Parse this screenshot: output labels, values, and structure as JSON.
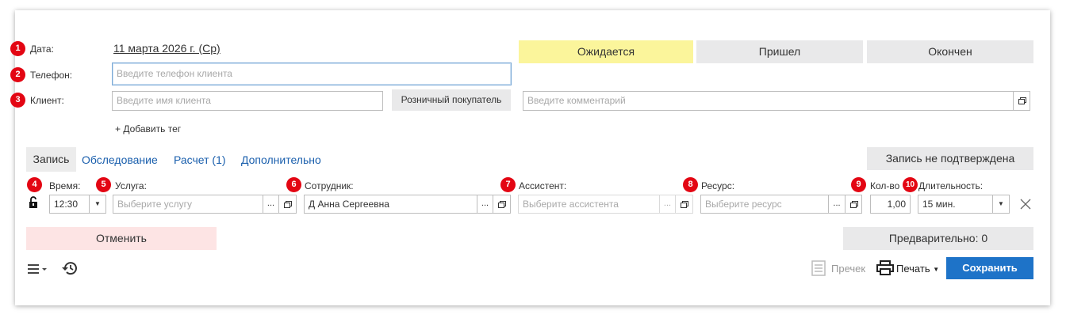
{
  "header": {
    "date_badge": "1",
    "date_label": "Дата:",
    "date_value": "11 марта 2026 г. (Ср)",
    "phone_badge": "2",
    "phone_label": "Телефон:",
    "phone_placeholder": "Введите телефон клиента",
    "client_badge": "3",
    "client_label": "Клиент:",
    "client_placeholder": "Введите имя клиента",
    "retail_button": "Розничный покупатель",
    "comment_placeholder": "Введите комментарий",
    "add_tag": "+ Добавить тег"
  },
  "status": {
    "waiting": "Ожидается",
    "arrived": "Пришел",
    "finished": "Окончен",
    "waiting_color": "#fbf59b"
  },
  "tabs": [
    "Запись",
    "Обследование",
    "Расчет (1)",
    "Дополнительно"
  ],
  "unconfirmed_button": "Запись не подтверждена",
  "row": {
    "time_badge": "4",
    "time_label": "Время:",
    "time_value": "12:30",
    "service_badge": "5",
    "service_label": "Услуга:",
    "service_placeholder": "Выберите услугу",
    "staff_badge": "6",
    "staff_label": "Сотрудник:",
    "staff_value": "Д Анна Сергеевна",
    "assistant_badge": "7",
    "assistant_label": "Ассистент:",
    "assistant_placeholder": "Выберите ассистента",
    "resource_badge": "8",
    "resource_label": "Ресурс:",
    "resource_placeholder": "Выберите ресурс",
    "qty_badge": "9",
    "qty_label": "Кол-во",
    "qty_value": "1,00",
    "duration_badge": "10",
    "duration_label": "Длительность:",
    "duration_value": "15 мин.",
    "ellipsis": "..."
  },
  "cancel_button": "Отменить",
  "prelim_button": "Предварительно: 0",
  "footer": {
    "receipt_label": "Пречек",
    "print_label": "Печать",
    "save_button": "Сохранить",
    "save_color": "#1e73c8"
  },
  "icons": {
    "menu": "menu-icon",
    "history": "history-icon",
    "lock": "unlock-icon",
    "clear": "close-icon",
    "receipt": "receipt-icon",
    "printer": "printer-icon",
    "popup": "popup-icon",
    "chevron": "chevron-down-icon"
  }
}
